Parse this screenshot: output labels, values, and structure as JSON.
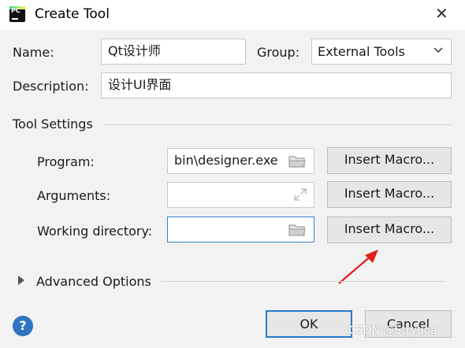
{
  "window": {
    "title": "Create Tool",
    "app_icon_text": "PC"
  },
  "form": {
    "name_label": "Name:",
    "name_value": "Qt设计师",
    "group_label": "Group:",
    "group_value": "External Tools",
    "description_label": "Description:",
    "description_value": "设计UI界面"
  },
  "tool_settings": {
    "heading": "Tool Settings",
    "program_label": "Program:",
    "program_value": "bin\\designer.exe",
    "arguments_label": "Arguments:",
    "arguments_value": "",
    "working_dir_label": "Working directory:",
    "working_dir_value": "",
    "insert_macro_label": "Insert Macro..."
  },
  "advanced": {
    "label": "Advanced Options"
  },
  "footer": {
    "help_label": "?",
    "ok_label": "OK",
    "cancel_label": "Cancel"
  },
  "watermark": "CSDN @Stryuoa",
  "colors": {
    "accent": "#2b78c9",
    "annotation_arrow": "#e0201b",
    "help": "#2f74c0"
  }
}
